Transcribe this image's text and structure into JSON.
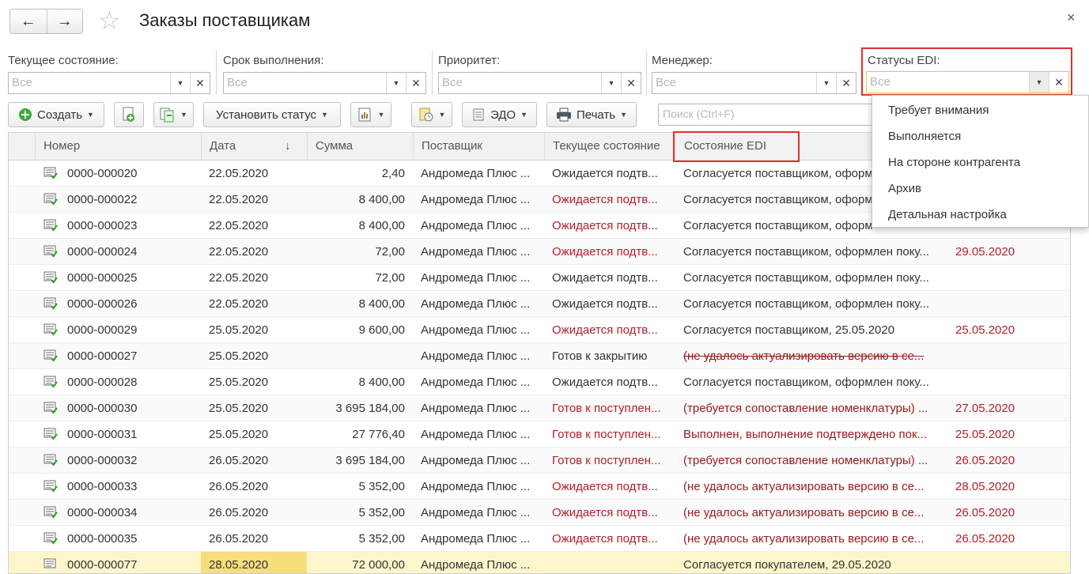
{
  "window": {
    "title": "Заказы поставщикам",
    "back_icon": "←",
    "forward_icon": "→",
    "favorite_icon": "☆",
    "close_icon": "×"
  },
  "filters": [
    {
      "label": "Текущее состояние:",
      "value": "Все"
    },
    {
      "label": "Срок выполнения:",
      "value": "Все"
    },
    {
      "label": "Приоритет:",
      "value": "Все"
    },
    {
      "label": "Менеджер:",
      "value": "Все"
    },
    {
      "label": "Статусы EDI:",
      "value": "Все"
    }
  ],
  "toolbar": {
    "create_label": "Создать",
    "set_status_label": "Установить статус",
    "edo_label": "ЭДО",
    "print_label": "Печать",
    "search_placeholder": "Поиск (Ctrl+F)"
  },
  "table": {
    "columns": [
      "Номер",
      "Дата",
      "Сумма",
      "Поставщик",
      "Текущее состояние",
      "Состояние EDI"
    ],
    "sort_icon": "↓",
    "rows": [
      {
        "num": "0000-000020",
        "date": "22.05.2020",
        "sum": "2,40",
        "supplier": "Андромеда Плюс ...",
        "state": "Ожидается подтв...",
        "state_style": "normal",
        "edi": "Согласуется поставщиком, оформ",
        "edi_style": "normal",
        "date2": ""
      },
      {
        "num": "0000-000022",
        "date": "22.05.2020",
        "sum": "8 400,00",
        "supplier": "Андромеда Плюс ...",
        "state": "Ожидается подтв...",
        "state_style": "red",
        "edi": "Согласуется поставщиком, оформ",
        "edi_style": "normal",
        "date2": ""
      },
      {
        "num": "0000-000023",
        "date": "22.05.2020",
        "sum": "8 400,00",
        "supplier": "Андромеда Плюс ...",
        "state": "Ожидается подтв...",
        "state_style": "red",
        "edi": "Согласуется поставщиком, оформ",
        "edi_style": "normal",
        "date2": ""
      },
      {
        "num": "0000-000024",
        "date": "22.05.2020",
        "sum": "72,00",
        "supplier": "Андромеда Плюс ...",
        "state": "Ожидается подтв...",
        "state_style": "red",
        "edi": "Согласуется поставщиком, оформлен поку...",
        "edi_style": "normal",
        "date2": "29.05.2020"
      },
      {
        "num": "0000-000025",
        "date": "22.05.2020",
        "sum": "72,00",
        "supplier": "Андромеда Плюс ...",
        "state": "Ожидается подтв...",
        "state_style": "normal",
        "edi": "Согласуется поставщиком, оформлен поку...",
        "edi_style": "normal",
        "date2": ""
      },
      {
        "num": "0000-000026",
        "date": "22.05.2020",
        "sum": "8 400,00",
        "supplier": "Андромеда Плюс ...",
        "state": "Ожидается подтв...",
        "state_style": "normal",
        "edi": "Согласуется поставщиком, оформлен поку...",
        "edi_style": "normal",
        "date2": ""
      },
      {
        "num": "0000-000029",
        "date": "25.05.2020",
        "sum": "9 600,00",
        "supplier": "Андромеда Плюс ...",
        "state": "Ожидается подтв...",
        "state_style": "red",
        "edi": "Согласуется поставщиком,  25.05.2020",
        "edi_style": "normal",
        "date2": "25.05.2020"
      },
      {
        "num": "0000-000027",
        "date": "25.05.2020",
        "sum": "",
        "supplier": "Андромеда Плюс ...",
        "state": "Готов к закрытию",
        "state_style": "normal",
        "edi": "(не удалось актуализировать версию в се...",
        "edi_style": "strike",
        "date2": ""
      },
      {
        "num": "0000-000028",
        "date": "25.05.2020",
        "sum": "8 400,00",
        "supplier": "Андромеда Плюс ...",
        "state": "Ожидается подтв...",
        "state_style": "normal",
        "edi": "Согласуется поставщиком, оформлен поку...",
        "edi_style": "normal",
        "date2": ""
      },
      {
        "num": "0000-000030",
        "date": "25.05.2020",
        "sum": "3 695 184,00",
        "supplier": "Андромеда Плюс ...",
        "state": "Готов к поступлен...",
        "state_style": "red",
        "edi": "(требуется сопоставление номенклатуры) ...",
        "edi_style": "red",
        "date2": "27.05.2020"
      },
      {
        "num": "0000-000031",
        "date": "25.05.2020",
        "sum": "27 776,40",
        "supplier": "Андромеда Плюс ...",
        "state": "Готов к поступлен...",
        "state_style": "red",
        "edi": "Выполнен, выполнение подтверждено пок...",
        "edi_style": "red",
        "date2": "25.05.2020"
      },
      {
        "num": "0000-000032",
        "date": "26.05.2020",
        "sum": "3 695 184,00",
        "supplier": "Андромеда Плюс ...",
        "state": "Готов к поступлен...",
        "state_style": "red",
        "edi": "(требуется сопоставление номенклатуры) ...",
        "edi_style": "red",
        "date2": "26.05.2020"
      },
      {
        "num": "0000-000033",
        "date": "26.05.2020",
        "sum": "5 352,00",
        "supplier": "Андромеда Плюс ...",
        "state": "Ожидается подтв...",
        "state_style": "red",
        "edi": "(не удалось актуализировать версию в се...",
        "edi_style": "red",
        "date2": "28.05.2020"
      },
      {
        "num": "0000-000034",
        "date": "26.05.2020",
        "sum": "5 352,00",
        "supplier": "Андромеда Плюс ...",
        "state": "Ожидается подтв...",
        "state_style": "red",
        "edi": "(не удалось актуализировать версию в се...",
        "edi_style": "red",
        "date2": "26.05.2020"
      },
      {
        "num": "0000-000035",
        "date": "26.05.2020",
        "sum": "5 352,00",
        "supplier": "Андромеда Плюс ...",
        "state": "Ожидается подтв...",
        "state_style": "red",
        "edi": "(не удалось актуализировать версию в се...",
        "edi_style": "red",
        "date2": "26.05.2020"
      },
      {
        "num": "0000-000077",
        "date": "28.05.2020",
        "sum": "72 000,00",
        "supplier": "Андромеда Плюс ...",
        "state": "",
        "state_style": "normal",
        "edi": "Согласуется покупателем,  29.05.2020",
        "edi_style": "normal",
        "date2": ""
      }
    ]
  },
  "edi_dropdown": {
    "items": [
      "Требует внимания",
      "Выполняется",
      "На стороне контрагента",
      "Архив",
      "Детальная настройка"
    ]
  },
  "colors": {
    "highlight_red": "#e03030",
    "status_red": "#b3202a",
    "selected_row": "#fdf6cc"
  }
}
